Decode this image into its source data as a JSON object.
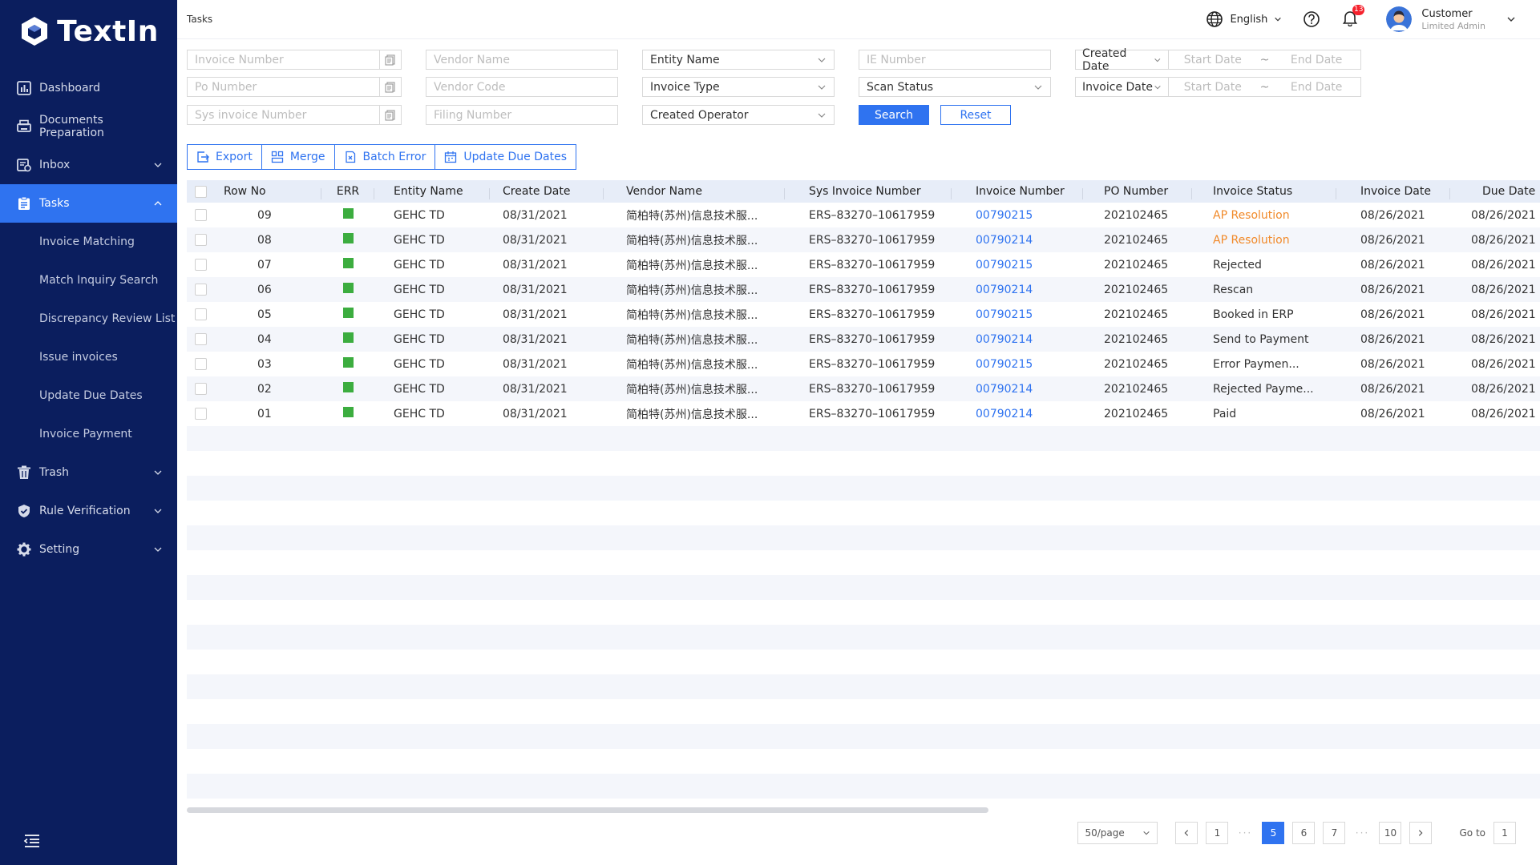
{
  "app": {
    "logo_text": "TextIn"
  },
  "sidebar": {
    "items": [
      {
        "label": "Dashboard"
      },
      {
        "label": "Documents Preparation"
      },
      {
        "label": "Inbox"
      },
      {
        "label": "Tasks"
      },
      {
        "label": "Trash"
      },
      {
        "label": "Rule Verification"
      },
      {
        "label": "Setting"
      }
    ],
    "tasks_sub": [
      {
        "label": "Invoice Matching"
      },
      {
        "label": "Match Inquiry Search"
      },
      {
        "label": "Discrepancy Review List"
      },
      {
        "label": "Issue invoices"
      },
      {
        "label": "Update Due Dates"
      },
      {
        "label": "Invoice Payment"
      }
    ]
  },
  "header": {
    "title": "Tasks",
    "language": "English",
    "notifications_count": "13",
    "user_name": "Customer",
    "user_role": "Limited Admin"
  },
  "filters": {
    "invoice_number": "Invoice Number",
    "po_number": "Po Number",
    "sys_invoice_number": "Sys invoice Number",
    "vendor_name": "Vendor Name",
    "vendor_code": "Vendor Code",
    "filing_number": "Filing Number",
    "entity_name": "Entity Name",
    "invoice_type": "Invoice Type",
    "created_operator": "Created Operator",
    "ie_number": "IE Number",
    "scan_status": "Scan Status",
    "created_date": "Created Date",
    "invoice_date": "Invoice Date",
    "start_date": "Start Date",
    "end_date": "End Date",
    "tilde": "~",
    "search_label": "Search",
    "reset_label": "Reset"
  },
  "toolbar": {
    "export": "Export",
    "merge": "Merge",
    "batch_error": "Batch Error",
    "update_due_dates": "Update Due Dates"
  },
  "table": {
    "columns": [
      "Row No",
      "ERR",
      "Entity Name",
      "Create Date",
      "Vendor Name",
      "Sys Invoice Number",
      "Invoice Number",
      "PO Number",
      "Invoice Status",
      "Invoice Date",
      "Due Date"
    ],
    "rows": [
      {
        "row_no": "09",
        "entity": "GEHC TD",
        "create_date": "08/31/2021",
        "vendor": "简柏特(苏州)信息技术服...",
        "sys_invoice": "ERS–83270–10617959",
        "invoice_number": "00790215",
        "po_number": "202102465",
        "status": "AP Resolution",
        "status_color": "#f18a2a",
        "invoice_date": "08/26/2021",
        "due_date": "08/26/2021"
      },
      {
        "row_no": "08",
        "entity": "GEHC TD",
        "create_date": "08/31/2021",
        "vendor": "简柏特(苏州)信息技术服...",
        "sys_invoice": "ERS–83270–10617959",
        "invoice_number": "00790214",
        "po_number": "202102465",
        "status": "AP Resolution",
        "status_color": "#f18a2a",
        "invoice_date": "08/26/2021",
        "due_date": "08/26/2021"
      },
      {
        "row_no": "07",
        "entity": "GEHC TD",
        "create_date": "08/31/2021",
        "vendor": "简柏特(苏州)信息技术服...",
        "sys_invoice": "ERS–83270–10617959",
        "invoice_number": "00790215",
        "po_number": "202102465",
        "status": "Rejected",
        "status_color": "#333333",
        "invoice_date": "08/26/2021",
        "due_date": "08/26/2021"
      },
      {
        "row_no": "06",
        "entity": "GEHC TD",
        "create_date": "08/31/2021",
        "vendor": "简柏特(苏州)信息技术服...",
        "sys_invoice": "ERS–83270–10617959",
        "invoice_number": "00790214",
        "po_number": "202102465",
        "status": "Rescan",
        "status_color": "#333333",
        "invoice_date": "08/26/2021",
        "due_date": "08/26/2021"
      },
      {
        "row_no": "05",
        "entity": "GEHC TD",
        "create_date": "08/31/2021",
        "vendor": "简柏特(苏州)信息技术服...",
        "sys_invoice": "ERS–83270–10617959",
        "invoice_number": "00790215",
        "po_number": "202102465",
        "status": "Booked in ERP",
        "status_color": "#333333",
        "invoice_date": "08/26/2021",
        "due_date": "08/26/2021"
      },
      {
        "row_no": "04",
        "entity": "GEHC TD",
        "create_date": "08/31/2021",
        "vendor": "简柏特(苏州)信息技术服...",
        "sys_invoice": "ERS–83270–10617959",
        "invoice_number": "00790214",
        "po_number": "202102465",
        "status": "Send to Payment",
        "status_color": "#333333",
        "invoice_date": "08/26/2021",
        "due_date": "08/26/2021"
      },
      {
        "row_no": "03",
        "entity": "GEHC TD",
        "create_date": "08/31/2021",
        "vendor": "简柏特(苏州)信息技术服...",
        "sys_invoice": "ERS–83270–10617959",
        "invoice_number": "00790215",
        "po_number": "202102465",
        "status": "Error Paymen...",
        "status_color": "#333333",
        "invoice_date": "08/26/2021",
        "due_date": "08/26/2021"
      },
      {
        "row_no": "02",
        "entity": "GEHC TD",
        "create_date": "08/31/2021",
        "vendor": "简柏特(苏州)信息技术服...",
        "sys_invoice": "ERS–83270–10617959",
        "invoice_number": "00790214",
        "po_number": "202102465",
        "status": "Rejected Payme...",
        "status_color": "#333333",
        "invoice_date": "08/26/2021",
        "due_date": "08/26/2021"
      },
      {
        "row_no": "01",
        "entity": "GEHC TD",
        "create_date": "08/31/2021",
        "vendor": "简柏特(苏州)信息技术服...",
        "sys_invoice": "ERS–83270–10617959",
        "invoice_number": "00790214",
        "po_number": "202102465",
        "status": "Paid",
        "status_color": "#333333",
        "invoice_date": "08/26/2021",
        "due_date": "08/26/2021"
      }
    ]
  },
  "pagination": {
    "page_size": "50/page",
    "pages": [
      "1",
      "5",
      "6",
      "7",
      "10"
    ],
    "current": "5",
    "dots": "···",
    "goto_label": "Go to",
    "goto_value": "1"
  },
  "colors": {
    "sidebar_bg": "#0b1e5e",
    "accent": "#2f73f0",
    "err_green": "#3cad3f",
    "status_orange": "#f18a2a"
  }
}
